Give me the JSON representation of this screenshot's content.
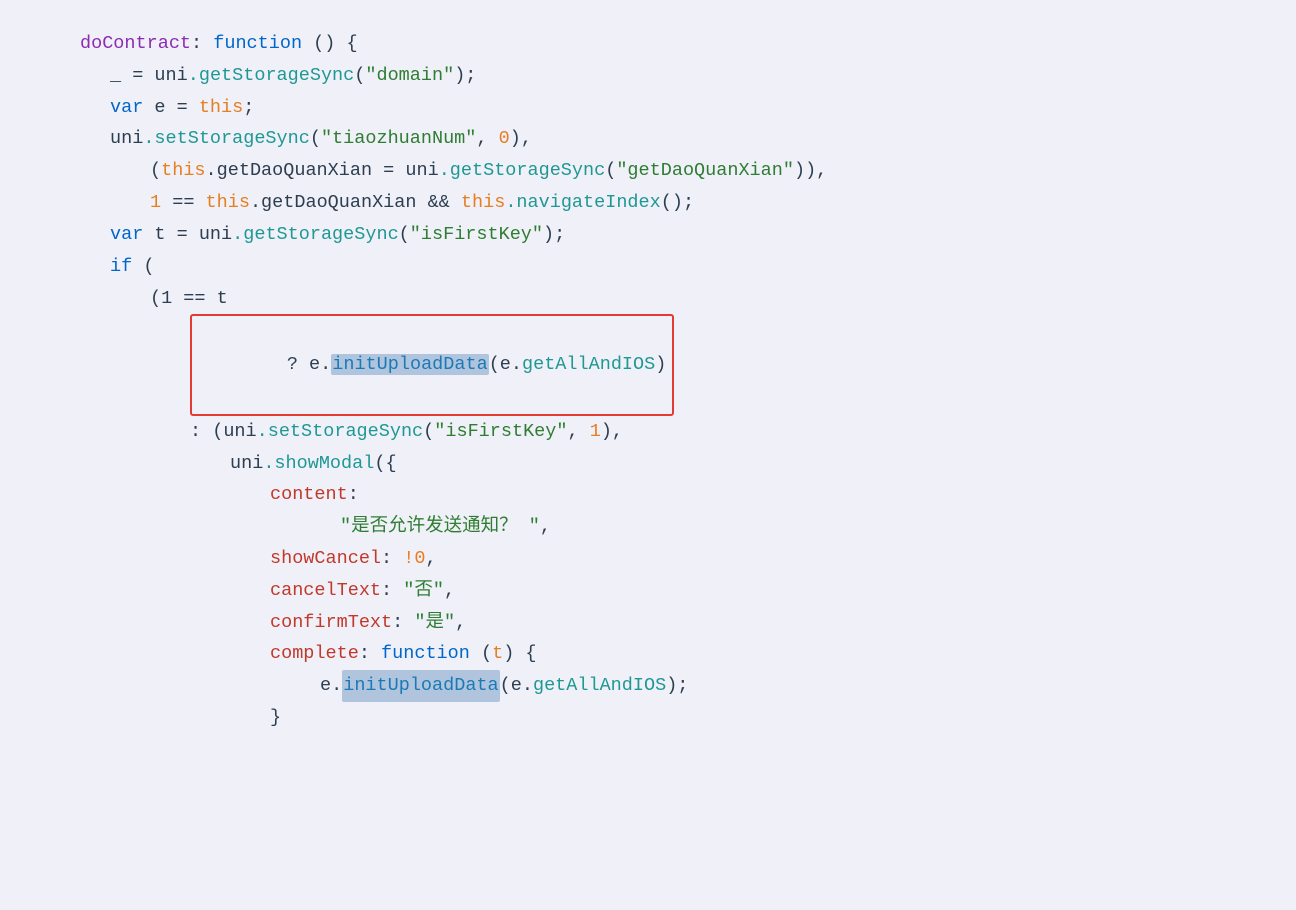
{
  "code": {
    "lines": [
      {
        "indent": 0,
        "tokens": [
          {
            "text": "doContract",
            "color": "purple"
          },
          {
            "text": ": ",
            "color": "dark"
          },
          {
            "text": "function",
            "color": "blue"
          },
          {
            "text": " () {",
            "color": "dark"
          }
        ]
      },
      {
        "indent": 1,
        "tokens": [
          {
            "text": "_",
            "color": "dark"
          },
          {
            "text": " = ",
            "color": "dark"
          },
          {
            "text": "uni",
            "color": "dark"
          },
          {
            "text": ".getStorageSync",
            "color": "cyan"
          },
          {
            "text": "(",
            "color": "dark"
          },
          {
            "text": "\"domain\"",
            "color": "green"
          },
          {
            "text": ");",
            "color": "dark"
          }
        ]
      },
      {
        "indent": 1,
        "tokens": [
          {
            "text": "var",
            "color": "blue"
          },
          {
            "text": " e = ",
            "color": "dark"
          },
          {
            "text": "this",
            "color": "orange"
          },
          {
            "text": ";",
            "color": "dark"
          }
        ]
      },
      {
        "indent": 1,
        "tokens": [
          {
            "text": "uni",
            "color": "dark"
          },
          {
            "text": ".setStorageSync",
            "color": "cyan"
          },
          {
            "text": "(",
            "color": "dark"
          },
          {
            "text": "\"tiaozhuanNum\"",
            "color": "green"
          },
          {
            "text": ", ",
            "color": "dark"
          },
          {
            "text": "0",
            "color": "orange"
          },
          {
            "text": "),",
            "color": "dark"
          }
        ]
      },
      {
        "indent": 2,
        "tokens": [
          {
            "text": "(",
            "color": "dark"
          },
          {
            "text": "this",
            "color": "orange"
          },
          {
            "text": ".getDaoQuanXian = ",
            "color": "dark"
          },
          {
            "text": "uni",
            "color": "dark"
          },
          {
            "text": ".getStorageSync",
            "color": "cyan"
          },
          {
            "text": "(",
            "color": "dark"
          },
          {
            "text": "\"getDaoQuanXian\"",
            "color": "green"
          },
          {
            "text": ")),",
            "color": "dark"
          }
        ]
      },
      {
        "indent": 2,
        "tokens": [
          {
            "text": "1 == ",
            "color": "orange"
          },
          {
            "text": "this",
            "color": "orange"
          },
          {
            "text": ".getDaoQuanXian && ",
            "color": "dark"
          },
          {
            "text": "this",
            "color": "orange"
          },
          {
            "text": ".navigateIndex",
            "color": "cyan"
          },
          {
            "text": "();",
            "color": "dark"
          }
        ]
      },
      {
        "indent": 1,
        "tokens": [
          {
            "text": "var",
            "color": "blue"
          },
          {
            "text": " t = ",
            "color": "dark"
          },
          {
            "text": "uni",
            "color": "dark"
          },
          {
            "text": ".getStorageSync",
            "color": "cyan"
          },
          {
            "text": "(",
            "color": "dark"
          },
          {
            "text": "\"isFirstKey\"",
            "color": "green"
          },
          {
            "text": ");",
            "color": "dark"
          }
        ]
      },
      {
        "indent": 1,
        "tokens": [
          {
            "text": "if",
            "color": "blue"
          },
          {
            "text": " (",
            "color": "dark"
          }
        ]
      },
      {
        "indent": 2,
        "tokens": [
          {
            "text": "(1 == t",
            "color": "dark"
          }
        ]
      },
      {
        "indent": 3,
        "highlight": true,
        "tokens": [
          {
            "text": "? e.",
            "color": "dark"
          },
          {
            "text": "initUploadData",
            "color": "method",
            "bg": true
          },
          {
            "text": "(e.",
            "color": "dark"
          },
          {
            "text": "getAllAndIOS",
            "color": "cyan"
          },
          {
            "text": ")",
            "color": "dark"
          }
        ]
      },
      {
        "indent": 3,
        "tokens": [
          {
            "text": ": (",
            "color": "dark"
          },
          {
            "text": "uni",
            "color": "dark"
          },
          {
            "text": ".setStorageSync",
            "color": "cyan"
          },
          {
            "text": "(",
            "color": "dark"
          },
          {
            "text": "\"isFirstKey\"",
            "color": "green"
          },
          {
            "text": ", ",
            "color": "dark"
          },
          {
            "text": "1",
            "color": "orange"
          },
          {
            "text": "),",
            "color": "dark"
          }
        ]
      },
      {
        "indent": 4,
        "tokens": [
          {
            "text": "uni",
            "color": "dark"
          },
          {
            "text": ".showModal",
            "color": "cyan"
          },
          {
            "text": "({",
            "color": "dark"
          }
        ]
      },
      {
        "indent": 5,
        "tokens": [
          {
            "text": "content",
            "color": "red"
          },
          {
            "text": ":",
            "color": "dark"
          }
        ]
      },
      {
        "indent": 6,
        "tokens": [
          {
            "text": "\"是否允许发送通知？\"",
            "color": "green"
          },
          {
            "text": ",",
            "color": "dark"
          }
        ]
      },
      {
        "indent": 5,
        "tokens": [
          {
            "text": "showCancel",
            "color": "red"
          },
          {
            "text": ": ",
            "color": "dark"
          },
          {
            "text": "!0",
            "color": "orange"
          },
          {
            "text": ",",
            "color": "dark"
          }
        ]
      },
      {
        "indent": 5,
        "tokens": [
          {
            "text": "cancelText",
            "color": "red"
          },
          {
            "text": ": ",
            "color": "dark"
          },
          {
            "text": "\"否\"",
            "color": "green"
          },
          {
            "text": ",",
            "color": "dark"
          }
        ]
      },
      {
        "indent": 5,
        "tokens": [
          {
            "text": "confirmText",
            "color": "red"
          },
          {
            "text": ": ",
            "color": "dark"
          },
          {
            "text": "\"是\"",
            "color": "green"
          },
          {
            "text": ",",
            "color": "dark"
          }
        ]
      },
      {
        "indent": 5,
        "tokens": [
          {
            "text": "complete",
            "color": "red"
          },
          {
            "text": ": ",
            "color": "dark"
          },
          {
            "text": "function",
            "color": "blue"
          },
          {
            "text": " (",
            "color": "dark"
          },
          {
            "text": "t",
            "color": "orange"
          },
          {
            "text": ") {",
            "color": "dark"
          }
        ]
      },
      {
        "indent": 6,
        "tokens": [
          {
            "text": "e.",
            "color": "dark"
          },
          {
            "text": "initUploadData",
            "color": "method",
            "bg": true
          },
          {
            "text": "(e.",
            "color": "dark"
          },
          {
            "text": "getAllAndIOS",
            "color": "cyan"
          },
          {
            "text": ");",
            "color": "dark"
          }
        ]
      },
      {
        "indent": 5,
        "tokens": [
          {
            "text": "}",
            "color": "dark"
          }
        ]
      }
    ]
  }
}
